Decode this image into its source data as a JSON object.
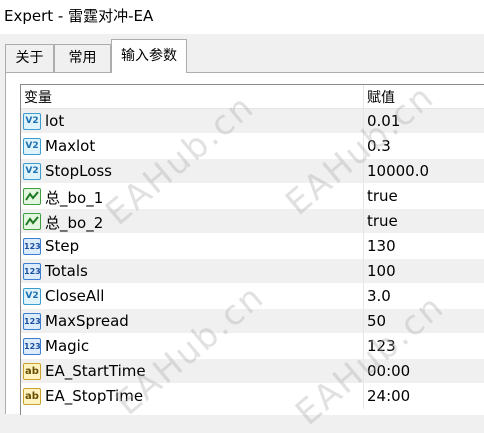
{
  "window": {
    "title": "Expert - 雷霆对冲-EA"
  },
  "tabs": [
    {
      "label": "关于"
    },
    {
      "label": "常用"
    },
    {
      "label": "输入参数",
      "active": true
    }
  ],
  "table": {
    "columns": [
      "变量",
      "赋值"
    ],
    "rows": [
      {
        "icon": "double-value-icon",
        "name": "lot",
        "value": "0.01"
      },
      {
        "icon": "double-value-icon",
        "name": "Maxlot",
        "value": "0.3"
      },
      {
        "icon": "double-value-icon",
        "name": "StopLoss",
        "value": "10000.0"
      },
      {
        "icon": "bool-value-icon",
        "name": "总_bo_1",
        "value": "true"
      },
      {
        "icon": "bool-value-icon",
        "name": "总_bo_2",
        "value": "true"
      },
      {
        "icon": "integer-value-icon",
        "name": "Step",
        "value": "130"
      },
      {
        "icon": "integer-value-icon",
        "name": "Totals",
        "value": "100"
      },
      {
        "icon": "double-value-icon",
        "name": "CloseAll",
        "value": "3.0"
      },
      {
        "icon": "integer-value-icon",
        "name": "MaxSpread",
        "value": "50"
      },
      {
        "icon": "integer-value-icon",
        "name": "Magic",
        "value": "123"
      },
      {
        "icon": "string-value-icon",
        "name": "EA_StartTime",
        "value": "00:00"
      },
      {
        "icon": "string-value-icon",
        "name": "EA_StopTime",
        "value": "24:00"
      }
    ]
  },
  "watermark": {
    "text": "EAHub.cn"
  }
}
